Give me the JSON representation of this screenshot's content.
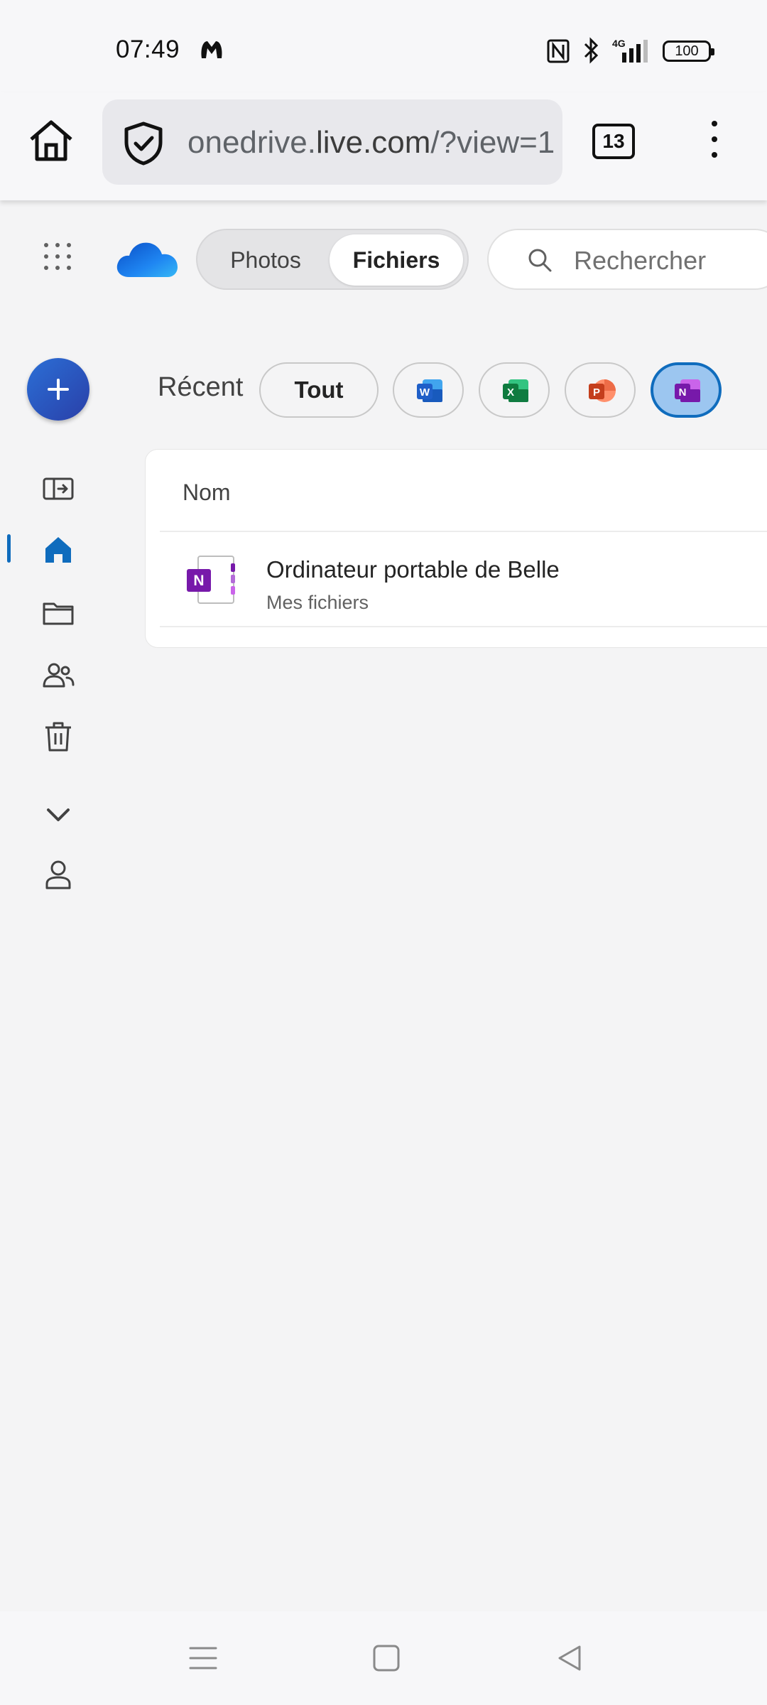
{
  "status_bar": {
    "time": "07:49",
    "network": "4G",
    "battery": "100",
    "icons": [
      "app-notification-icon",
      "nfc-icon",
      "bluetooth-icon",
      "signal-icon",
      "battery-icon"
    ]
  },
  "browser": {
    "url_domain_prefix": "onedrive.",
    "url_domain_main": "live.com",
    "url_path": "/?view=1",
    "tab_count": "13"
  },
  "header": {
    "segment_photos": "Photos",
    "segment_files": "Fichiers",
    "search_placeholder": "Rechercher"
  },
  "filters": {
    "recent_label": "Récent",
    "all_label": "Tout",
    "apps": [
      "word-icon",
      "excel-icon",
      "powerpoint-icon",
      "onenote-icon"
    ],
    "selected": "onenote-icon"
  },
  "file_list": {
    "column_name": "Nom",
    "rows": [
      {
        "name": "Ordinateur portable de Belle",
        "location": "Mes fichiers",
        "type": "onenote-notebook-icon"
      }
    ]
  },
  "rail": {
    "items": [
      "collapse-pane-icon",
      "home-icon",
      "folder-icon",
      "shared-icon",
      "recycle-bin-icon",
      "chevron-down-icon",
      "account-icon"
    ],
    "active": "home-icon"
  },
  "colors": {
    "accent": "#0f6cbd",
    "onenote": "#7719aa",
    "background": "#f4f4f5"
  }
}
